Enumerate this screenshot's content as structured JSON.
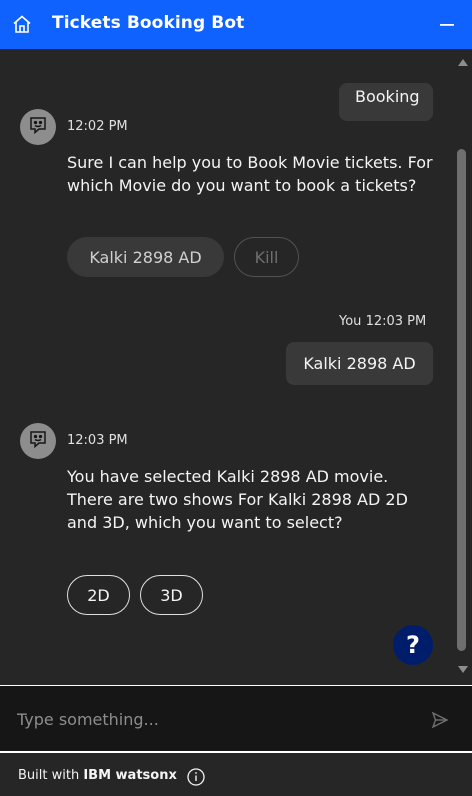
{
  "header": {
    "title": "Tickets Booking Bot",
    "accent": "#0f62fe"
  },
  "messages": {
    "prev_user_fragment": "Booking",
    "bot1": {
      "time": "12:02 PM",
      "text": "Sure I can help you to Book Movie tickets. For which Movie do you want to book a tickets?",
      "options": [
        "Kalki 2898 AD",
        "Kill"
      ]
    },
    "user1": {
      "sender": "You",
      "time": "12:03 PM",
      "text": "Kalki 2898 AD"
    },
    "bot2": {
      "time": "12:03 PM",
      "text": "You have selected Kalki 2898 AD movie. There are two shows For Kalki 2898 AD 2D and 3D, which you want to select?",
      "options": [
        "2D",
        "3D"
      ]
    }
  },
  "help": {
    "label": "?"
  },
  "input": {
    "placeholder": "Type something..."
  },
  "footer": {
    "prefix": "Built with ",
    "brand": "IBM watsonx"
  },
  "icons": {
    "home": "home-icon",
    "minimize": "minimize-icon",
    "bot_avatar": "chat-bot-icon",
    "send": "send-icon",
    "info": "info-icon"
  }
}
